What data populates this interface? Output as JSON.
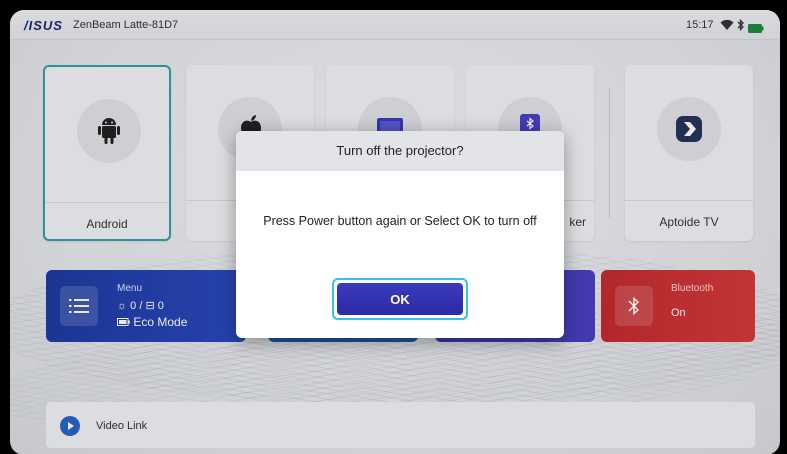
{
  "status_bar": {
    "brand": "/ISUS",
    "device_name": "ZenBeam Latte-81D7",
    "time": "15:17",
    "icons": [
      "wifi-icon",
      "bluetooth-icon",
      "battery-icon"
    ]
  },
  "apps": [
    {
      "id": "android",
      "label": "Android",
      "icon": "android-icon"
    },
    {
      "id": "apple",
      "label": "",
      "icon": "apple-icon"
    },
    {
      "id": "screen",
      "label": "",
      "icon": "screen-mirror-icon"
    },
    {
      "id": "speaker",
      "label": "ker",
      "icon": "bluetooth-speaker-icon"
    },
    {
      "id": "aptoide",
      "label": "Aptoide TV",
      "icon": "aptoide-icon"
    }
  ],
  "cards": {
    "menu": {
      "title": "Menu",
      "brightness": "0",
      "separator": "/",
      "keystone": "0",
      "mode": "Eco Mode"
    },
    "bluetooth": {
      "title": "Bluetooth",
      "state": "On"
    }
  },
  "bottom_bar": {
    "label": "Video Link"
  },
  "dialog": {
    "title": "Turn off the projector?",
    "message": "Press Power button again or Select OK to turn off",
    "ok_label": "OK"
  },
  "colors": {
    "accent_focus": "#2f9fa8",
    "dialog_button": "#2c2aa3",
    "menu_card": "#1e3aa0",
    "bluetooth_card": "#c22b2e"
  }
}
